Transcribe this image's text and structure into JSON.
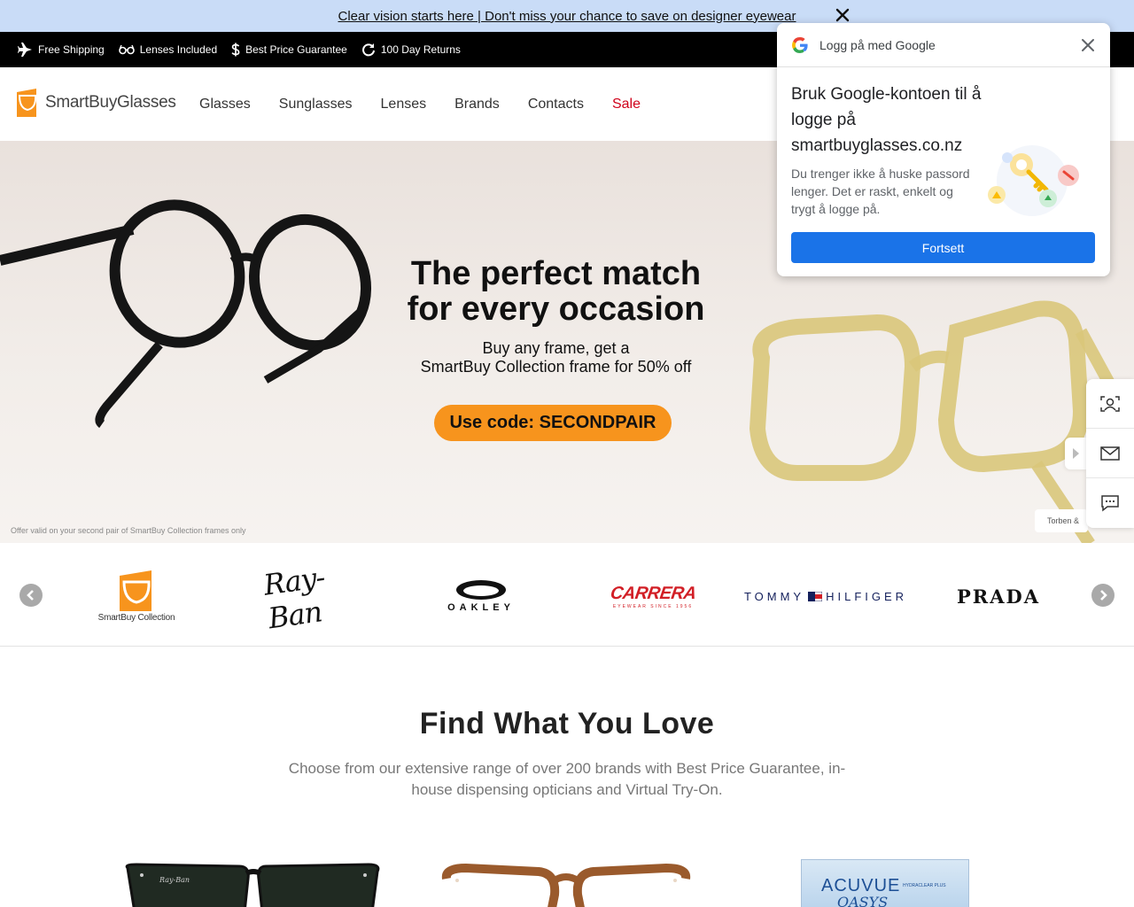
{
  "promo": {
    "text": "Clear vision starts here | Don't miss your chance to save on designer eyewear",
    "close_icon": "close-icon"
  },
  "usp": [
    {
      "label": "Free Shipping",
      "icon": "plane-icon"
    },
    {
      "label": "Lenses Included",
      "icon": "glasses-icon"
    },
    {
      "label": "Best Price Guarantee",
      "icon": "dollar-icon"
    },
    {
      "label": "100 Day Returns",
      "icon": "refresh-icon"
    }
  ],
  "header": {
    "logo_text": "SmartBuyGlasses",
    "nav": [
      "Glasses",
      "Sunglasses",
      "Lenses",
      "Brands",
      "Contacts",
      "Sale"
    ]
  },
  "hero": {
    "title_line1": "The perfect match",
    "title_line2": "for every occasion",
    "subtitle_line1": "Buy any frame, get a",
    "subtitle_line2": "SmartBuy Collection frame for 50% off",
    "cta": "Use code: SECONDPAIR",
    "disclaimer": "Offer valid on your second pair of SmartBuy Collection frames only",
    "credit": "Torben &"
  },
  "brands": {
    "smartbuy_collection": "SmartBuy Collection",
    "rayban": "Ray-Ban",
    "oakley": "OAKLEY",
    "carrera": "CARRERA",
    "carrera_sub": "EYEWEAR SINCE 1956",
    "tommy_left": "TOMMY",
    "tommy_right": "HILFIGER",
    "prada": "PRADA"
  },
  "find": {
    "title": "Find What You Love",
    "subtitle": "Choose from our extensive range of over 200 brands with Best Price Guarantee, in-house dispensing opticians and Virtual Try-On."
  },
  "products": {
    "acuvue_brand": "ACUVUE",
    "acuvue_line": "OASYS",
    "acuvue_tag": "HYDRACLEAR PLUS",
    "rayban_temple": "Ray-Ban"
  },
  "google_popup": {
    "header": "Logg på med Google",
    "title": "Bruk Google-kontoen til å logge på smartbuyglasses.co.nz",
    "description": "Du trenger ikke å huske passord lenger. Det er raskt, enkelt og trygt å logge på.",
    "button": "Fortsett"
  },
  "colors": {
    "accent": "#f7941d",
    "sale": "#d0021b",
    "google_blue": "#1a73e8",
    "promo_bg": "#c9dcf7"
  }
}
